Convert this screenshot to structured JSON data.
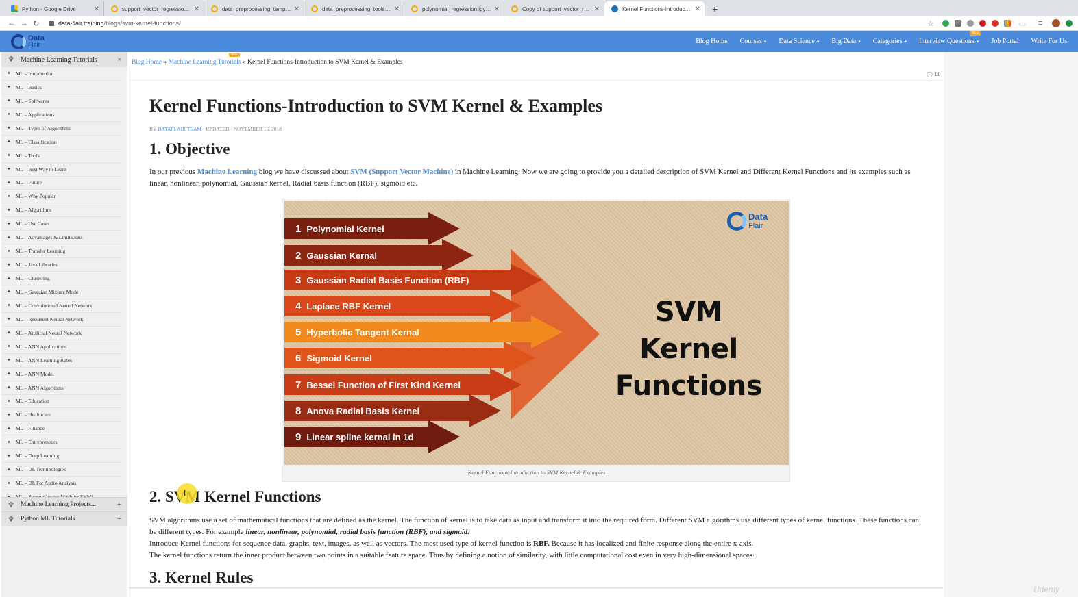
{
  "browser": {
    "tabs": [
      {
        "label": "Python - Google Drive",
        "icon": "drive-icon",
        "active": false
      },
      {
        "label": "support_vector_regression.ipynb",
        "icon": "colab-icon",
        "active": false
      },
      {
        "label": "data_preprocessing_template.ipynb",
        "icon": "colab-icon",
        "active": false
      },
      {
        "label": "data_preprocessing_tools.ipynb",
        "icon": "colab-icon",
        "active": false
      },
      {
        "label": "polynomial_regression.ipynb - C",
        "icon": "colab-icon",
        "active": false
      },
      {
        "label": "Copy of support_vector_regressi",
        "icon": "colab-icon",
        "active": false
      },
      {
        "label": "Kernel Functions-Introduction to",
        "icon": "dataflair-icon",
        "active": true
      }
    ],
    "url_host": "data-flair.training",
    "url_path": "/blogs/svm-kernel-functions/"
  },
  "header": {
    "logo_line1": "Data",
    "logo_line2": "Flair",
    "nav": [
      {
        "label": "Blog Home",
        "dropdown": false
      },
      {
        "label": "Courses",
        "dropdown": true
      },
      {
        "label": "Data Science",
        "dropdown": true
      },
      {
        "label": "Big Data",
        "dropdown": true
      },
      {
        "label": "Categories",
        "dropdown": true
      },
      {
        "label": "Interview Questions",
        "dropdown": true,
        "badge": "New"
      },
      {
        "label": "Job Portal",
        "dropdown": false
      },
      {
        "label": "Write For Us",
        "dropdown": false
      }
    ]
  },
  "sidebar": {
    "title": "Machine Learning Tutorials",
    "close": "×",
    "items": [
      "ML – Introduction",
      "ML – Basics",
      "ML – Softwares",
      "ML – Applications",
      "ML – Types of Algorithms",
      "ML – Classification",
      "ML – Tools",
      "ML – Best Way to Learn",
      "ML – Future",
      "ML – Why Popular",
      "ML – Algorithms",
      "ML – Use Cases",
      "ML – Advantages & Limitations",
      "ML – Transfer Learning",
      "ML – Java Libraries",
      "ML – Clustering",
      "ML – Gaussian Mixture Model",
      "ML – Convolutional Neural Network",
      "ML – Recurrent Neural Network",
      "ML – Artificial Neural Network",
      "ML – ANN Applications",
      "ML – ANN Learning Rules",
      "ML – ANN Model",
      "ML – ANN Algorithms",
      "ML – Education",
      "ML – Healthcare",
      "ML – Finance",
      "ML – Entrepreneurs",
      "ML – Deep Learning",
      "ML – DL Terminologies",
      "ML – DL For Audio Analysis",
      "ML – Support Vector Machine(SVM)"
    ],
    "sections": [
      {
        "label": "Machine Learning Projects...",
        "ctl": "+"
      },
      {
        "label": "Python ML Tutorials",
        "ctl": "+"
      }
    ]
  },
  "breadcrumb": {
    "home": "Blog Home",
    "sep1": " » ",
    "parent": "Machine Learning Tutorials",
    "parent_badge": "New",
    "sep2": " » ",
    "current": "Kernel Functions-Introduction to SVM Kernel & Examples"
  },
  "comments_count": "11",
  "article": {
    "title": "Kernel Functions-Introduction to SVM Kernel & Examples",
    "meta_by": "BY ",
    "meta_author": "DATAFLAIR TEAM",
    "meta_rest": " · UPDATED · NOVEMBER 16, 2018",
    "h_objective": "1. Objective",
    "p1_a": "In our previous ",
    "p1_link1": "Machine Learning",
    "p1_b": " blog we have discussed about ",
    "p1_link2": "SVM (Support Vector Machine)",
    "p1_c": " in Machine Learning. Now we are going to provide you a detailed description of SVM Kernel and Different Kernel Functions and its examples such as linear, nonlinear, polynomial, Gaussian kernel, Radial basis function (RBF), sigmoid etc.",
    "figure": {
      "title_line1": "SVM Kernel",
      "title_line2": "Functions",
      "logo_line1": "Data",
      "logo_line2": "Flair",
      "kernels": [
        {
          "num": "1",
          "label": "Polynomial Kernel",
          "color": "#7a1f10"
        },
        {
          "num": "2",
          "label": "Gaussian Kernal",
          "color": "#8e2712"
        },
        {
          "num": "3",
          "label": "Gaussian Radial Basis Function (RBF)",
          "color": "#c63a16"
        },
        {
          "num": "4",
          "label": "Laplace RBF Kernel",
          "color": "#d9481a"
        },
        {
          "num": "5",
          "label": "Hyperbolic Tangent Kernal",
          "color": "#f08a1e"
        },
        {
          "num": "6",
          "label": "Sigmoid Kernel",
          "color": "#df541b"
        },
        {
          "num": "7",
          "label": "Bessel Function of First Kind Kernel",
          "color": "#c83d17"
        },
        {
          "num": "8",
          "label": "Anova Radial Basis Kernel",
          "color": "#9a2c13"
        },
        {
          "num": "9",
          "label": "Linear spline kernal in 1d",
          "color": "#6f1b0e"
        }
      ],
      "caption": "Kernel Functions-Introduction to SVM Kernel & Examples"
    },
    "h_svm": "2. SVM Kernel Functions",
    "p2_a": "SVM algorithms use a set of mathematical functions that are defined as the kernel. The function of kernel is to take data as input and transform it into the required form. Different SVM algorithms use different types of kernel functions. These functions can be different types. For example ",
    "p2_em": "linear, nonlinear, polynomial, radial basis function (RBF), and sigmoid.",
    "p3_a": "Introduce Kernel functions for sequence data, graphs, text, images, as well as vectors. The most used type of kernel function is ",
    "p3_b": "RBF.",
    "p3_c": " Because it has localized and finite response along the entire x-axis.",
    "p4": "The kernel functions return the inner product between two points in a suitable feature space. Thus by defining a notion of similarity, with little computational cost even in very high-dimensional spaces.",
    "h_rules": "3. Kernel Rules"
  },
  "watermark": "Udemy"
}
